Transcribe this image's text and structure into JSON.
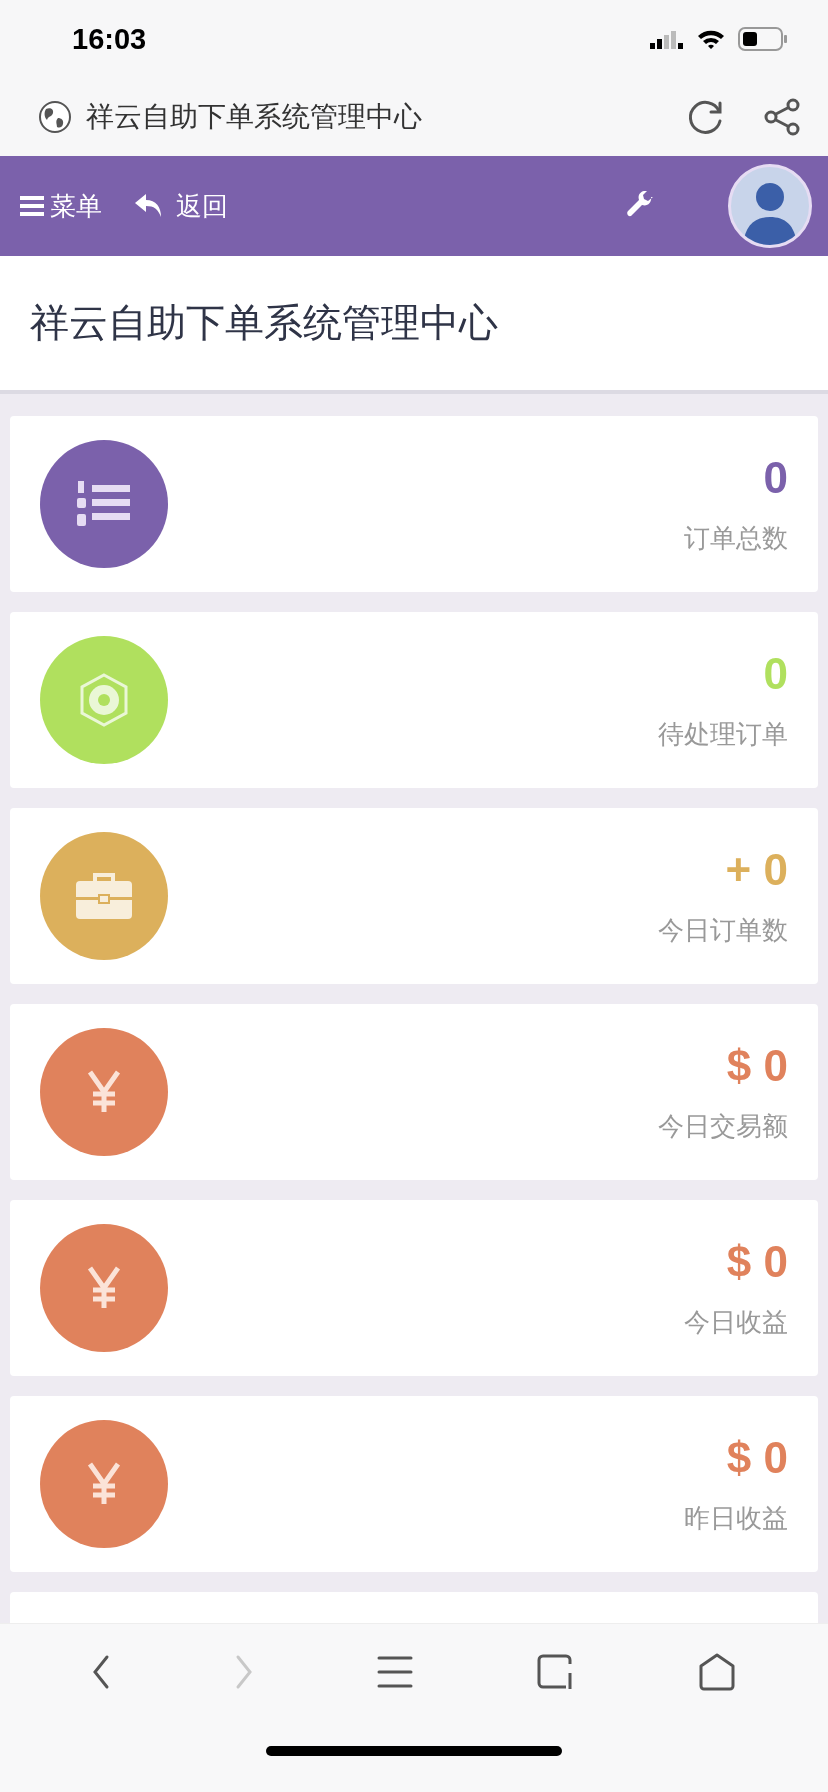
{
  "status_bar": {
    "time": "16:03"
  },
  "browser_bar": {
    "title": "祥云自助下单系统管理中心"
  },
  "nav": {
    "menu_label": "菜单",
    "back_label": "返回"
  },
  "page_title": "祥云自助下单系统管理中心",
  "stats": [
    {
      "kind": "list",
      "color": "#7b61ab",
      "value": "0",
      "label": "订单总数"
    },
    {
      "kind": "emblem",
      "color": "#b0e05e",
      "value": "0",
      "label": "待处理订单"
    },
    {
      "kind": "briefcase",
      "color": "#dcb05c",
      "value": "+ 0",
      "label": "今日订单数"
    },
    {
      "kind": "yen",
      "color": "#e0825c",
      "value": "$ 0",
      "label": "今日交易额"
    },
    {
      "kind": "yen",
      "color": "#e0825c",
      "value": "$ 0",
      "label": "今日收益"
    },
    {
      "kind": "yen",
      "color": "#e0825c",
      "value": "$ 0",
      "label": "昨日收益"
    }
  ],
  "toolbar": {
    "back_disabled": false,
    "forward_disabled": true
  }
}
